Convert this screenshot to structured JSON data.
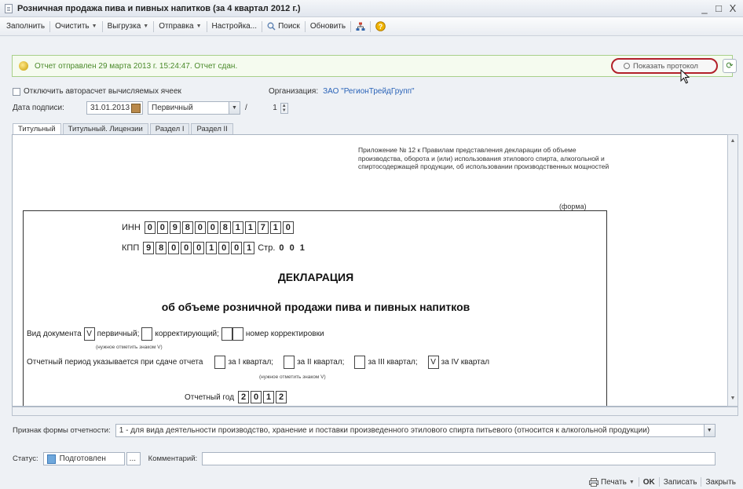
{
  "window": {
    "title": "Розничная продажа пива и пивных напитков (за 4 квартал 2012 г.)",
    "minimize": "_",
    "maximize": "□",
    "close": "X"
  },
  "toolbar": {
    "fill": "Заполнить",
    "clear": "Очистить",
    "export": "Выгрузка",
    "send": "Отправка",
    "settings": "Настройка...",
    "search": "Поиск",
    "update": "Обновить"
  },
  "notice": {
    "message": "Отчет отправлен 29 марта 2013 г. 15:24:47. Отчет сдан.",
    "protocol_button": "Показать протокол"
  },
  "options": {
    "autocalc_label": "Отключить авторасчет вычисляемых ячеек",
    "org_label": "Организация:",
    "org_value": "ЗАО \"РегионТрейдГрупп\"",
    "sign_date_label": "Дата подписи:",
    "sign_date_value": "31.01.2013",
    "doc_kind_value": "Первичный",
    "slash": "/",
    "number_value": "1"
  },
  "tabs": [
    "Титульный",
    "Титульный. Лицензии",
    "Раздел I",
    "Раздел II"
  ],
  "form": {
    "appendix_text": "Приложение № 12 к Правилам представления декларации об объеме производства, оборота и (или) использования этилового спирта, алкогольной и спиртосодержащей продукции, об использовании производственных мощностей",
    "forma": "(форма)",
    "inn_label": "ИНН",
    "inn_digits": [
      "0",
      "0",
      "9",
      "8",
      "0",
      "0",
      "8",
      "1",
      "1",
      "7",
      "1",
      "0"
    ],
    "kpp_label": "КПП",
    "kpp_digits": [
      "9",
      "8",
      "0",
      "0",
      "0",
      "1",
      "0",
      "0",
      "1"
    ],
    "page_label": "Стр.",
    "page_value": "0 0 1",
    "heading": "ДЕКЛАРАЦИЯ",
    "subheading": "об объеме розничной продажи пива и пивных напитков",
    "vid_label": "Вид документа",
    "vid_primary_mark": "V",
    "vid_primary": "первичный;",
    "vid_corrective": "корректирующий;",
    "vid_corr_number": "номер корректировки",
    "note_v1": "(нужное отметить знаком V)",
    "period_label": "Отчетный период указывается при сдаче отчета",
    "q1": "за I квартал;",
    "q2": "за II квартал;",
    "q3": "за III квартал;",
    "q4_mark": "V",
    "q4": "за IV квартал",
    "note_v2": "(нужное отметить знаком V)",
    "year_label": "Отчетный год",
    "year_digits": [
      "2",
      "0",
      "1",
      "2"
    ]
  },
  "sign": {
    "label": "Признак формы отчетности:",
    "value": "1 - для вида деятельности производство, хранение и поставки произведенного этилового спирта питьевого (относится к алкогольной продукции)"
  },
  "status": {
    "label": "Статус:",
    "value": "Подготовлен",
    "ellipsis": "...",
    "comment_label": "Комментарий:"
  },
  "bottom": {
    "print": "Печать",
    "ok": "OK",
    "save": "Записать",
    "close": "Закрыть"
  },
  "colors": {
    "notice_text": "#4a8a2a",
    "highlight_ring": "#b2202a",
    "link": "#2a63b8"
  }
}
